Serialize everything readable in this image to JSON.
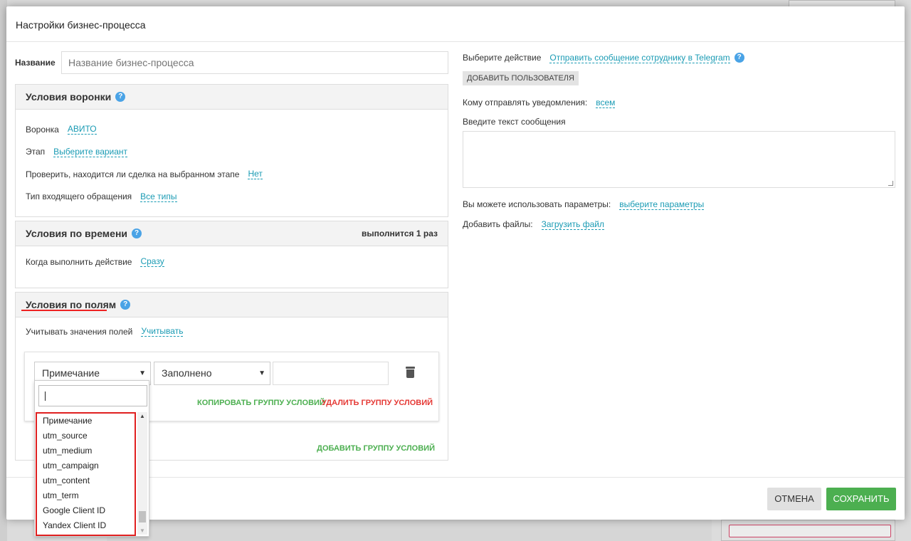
{
  "modal": {
    "title": "Настройки бизнес-процесса"
  },
  "name_field": {
    "label": "Название",
    "placeholder": "Название бизнес-процесса"
  },
  "funnel_conditions": {
    "title": "Условия воронки",
    "rows": [
      {
        "label": "Воронка",
        "value": "АВИТО"
      },
      {
        "label": "Этап",
        "value": "Выберите вариант"
      },
      {
        "label": "Проверить, находится ли сделка на выбранном этапе",
        "value": "Нет"
      },
      {
        "label": "Тип входящего обращения",
        "value": "Все типы"
      }
    ]
  },
  "time_conditions": {
    "title": "Условия по времени",
    "right_note": "выполнится 1 раз",
    "row": {
      "label": "Когда выполнить действие",
      "value": "Сразу"
    }
  },
  "field_conditions": {
    "title": "Условия по полям",
    "row": {
      "label": "Учитывать значения полей",
      "value": "Учитывать"
    },
    "group": {
      "field_select": "Примечание",
      "operator_select": "Заполнено",
      "copy_label": "Копировать группу условий",
      "delete_label": "Удалить группу условий"
    },
    "add_group_label": "Добавить группу условий"
  },
  "dropdown": {
    "search_value": "",
    "options": [
      "Примечание",
      "utm_source",
      "utm_medium",
      "utm_campaign",
      "utm_content",
      "utm_term",
      "Google Client ID",
      "Yandex Client ID"
    ]
  },
  "action": {
    "label": "Выберите действие",
    "value": "Отправить сообщение сотруднику в Telegram",
    "add_user_label": "Добавить пользователя",
    "recipients_label": "Кому отправлять уведомления:",
    "recipients_value": "всем",
    "message_label": "Введите текст сообщения",
    "params_label": "Вы можете использовать параметры:",
    "params_value": "выберите параметры",
    "files_label": "Добавить файлы:",
    "files_value": "Загрузить файл"
  },
  "footer": {
    "cancel_label": "Отмена",
    "save_label": "Сохранить"
  },
  "colors": {
    "link": "#1a9bb4",
    "green": "#4caf50",
    "red": "#e53935",
    "help": "#4aa3e6"
  }
}
